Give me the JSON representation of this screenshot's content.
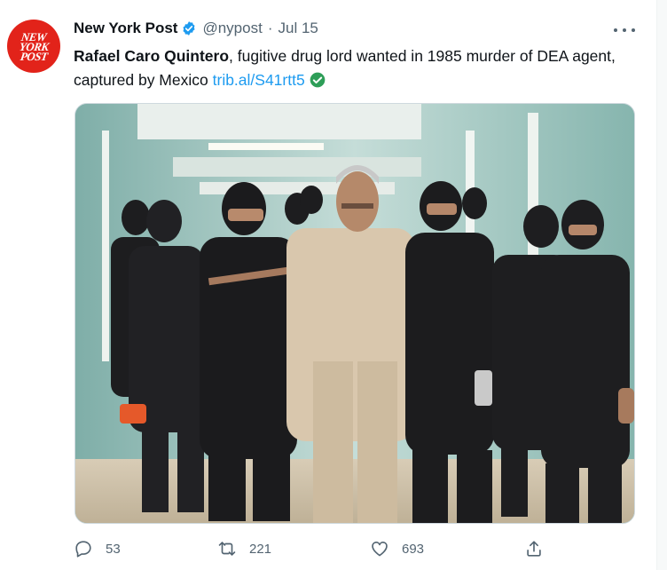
{
  "tweet": {
    "avatar_text": [
      "NEW",
      "YORK",
      "POST"
    ],
    "author_name": "New York Post",
    "handle": "@nypost",
    "separator": "·",
    "date": "Jul 15",
    "text_bold": "Rafael Caro Quintero",
    "text_rest": ", fugitive drug lord wanted in 1985 murder of DEA agent, captured by Mexico",
    "link": "trib.al/S41rtt5",
    "reply_count": "53",
    "retweet_count": "221",
    "like_count": "693"
  },
  "icons": {
    "verified": "verified-badge-icon",
    "more": "more-options-icon",
    "link_check": "check-circle-icon",
    "reply": "reply-icon",
    "retweet": "retweet-icon",
    "like": "heart-icon",
    "share": "share-icon"
  },
  "colors": {
    "brand_red": "#e2231a",
    "link_blue": "#1d9bf0",
    "check_green": "#2e9e58",
    "muted": "#536471"
  }
}
